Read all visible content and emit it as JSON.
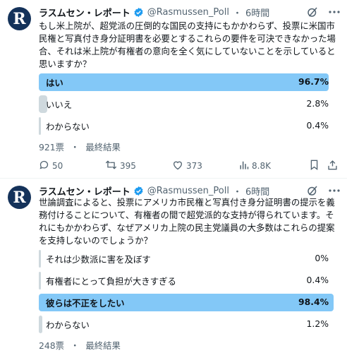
{
  "tweets": [
    {
      "avatar_letter": "R",
      "author": "ラスムセン・レポート",
      "handle": "@Rasmussen_Poll",
      "sep": "・",
      "time": "6時間",
      "text": "もし米上院が、超党派の圧倒的な国民の支持にもかかわらず、投票に米国市\n民権と写真付き身分証明書を必要とするこれらの要件を可決できなかった場\n合、それは米上院が有権者の意向を全く気にしていないことを示していると\n思いますか？",
      "poll": [
        {
          "label": "はい",
          "percent": "96.7%",
          "value": 96.7,
          "top": true
        },
        {
          "label": "いいえ",
          "percent": "2.8%",
          "value": 2.8,
          "top": false
        },
        {
          "label": "わからない",
          "percent": "0.4%",
          "value": 0.4,
          "top": false
        }
      ],
      "votes": "921票",
      "status": "最終結果",
      "actions": {
        "replies": "50",
        "retweets": "395",
        "likes": "373",
        "views": "8.8K"
      }
    },
    {
      "avatar_letter": "R",
      "author": "ラスムセン・レポート",
      "handle": "@Rasmussen_Poll",
      "sep": "・",
      "time": "6時間",
      "text": "世論調査によると、投票にアメリカ市民権と写真付き身分証明書の提示を義\n務付けることについて、有権者の間で超党派的な支持が得られています。そ\nれにもかかわらず、なぜアメリカ上院の民主党議員の大多数はこれらの提案\nを支持しないのでしょうか？",
      "poll": [
        {
          "label": "それは少数派に害を及ぼす",
          "percent": "0%",
          "value": 0,
          "top": false
        },
        {
          "label": "有権者にとって負担が大きすぎる",
          "percent": "0.4%",
          "value": 0.4,
          "top": false
        },
        {
          "label": "彼らは不正をしたい",
          "percent": "98.4%",
          "value": 98.4,
          "top": true
        },
        {
          "label": "わからない",
          "percent": "1.2%",
          "value": 1.2,
          "top": false
        }
      ],
      "votes": "248票",
      "status": "最終結果"
    }
  ],
  "colors": {
    "accent": "#1d9bf0",
    "muted": "#536471",
    "bar": "#cfd9de",
    "avatar": "#14325a"
  }
}
